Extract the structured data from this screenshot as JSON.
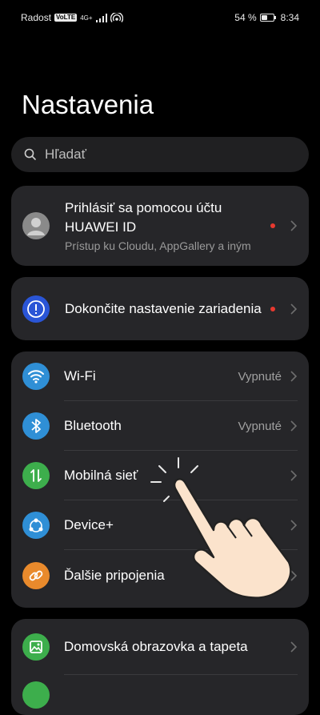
{
  "status": {
    "carrier": "Radost",
    "volte": "VoLTE",
    "network": "4G+",
    "battery": "54 %",
    "battery_level": 0.54,
    "time": "8:34"
  },
  "page": {
    "title": "Nastavenia"
  },
  "search": {
    "placeholder": "Hľadať"
  },
  "account": {
    "title": "Prihlásiť sa pomocou účtu HUAWEI ID",
    "subtitle": "Prístup ku Cloudu, AppGallery a iným"
  },
  "setup": {
    "title": "Dokončite nastavenie zariadenia"
  },
  "connections": [
    {
      "label": "Wi-Fi",
      "value": "Vypnuté",
      "icon": "wifi-icon",
      "color": "#2f8fd6"
    },
    {
      "label": "Bluetooth",
      "value": "Vypnuté",
      "icon": "bluetooth-icon",
      "color": "#2f8fd6"
    },
    {
      "label": "Mobilná sieť",
      "value": "",
      "icon": "mobile-network-icon",
      "color": "#3dae4c"
    },
    {
      "label": "Device+",
      "value": "",
      "icon": "device-plus-icon",
      "color": "#2f8fd6"
    },
    {
      "label": "Ďalšie pripojenia",
      "value": "",
      "icon": "link-icon",
      "color": "#e98a2c"
    }
  ],
  "display": [
    {
      "label": "Domovská obrazovka a tapeta",
      "icon": "home-screen-icon",
      "color": "#3dae4c"
    }
  ],
  "colors": {
    "notification_dot": "#e8392f",
    "card": "#262629"
  }
}
